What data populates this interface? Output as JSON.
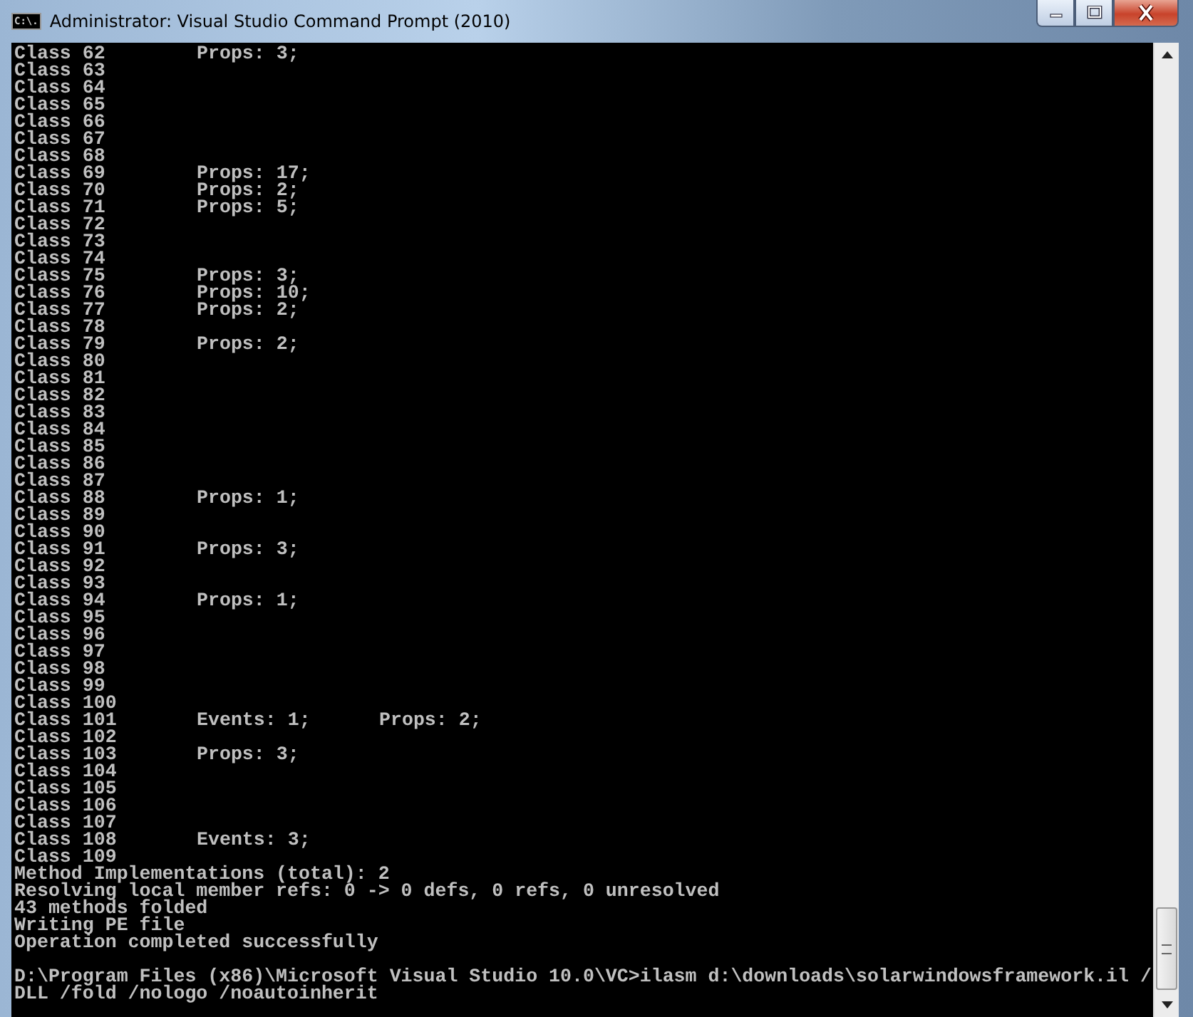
{
  "window": {
    "title": "Administrator: Visual Studio Command Prompt (2010)",
    "icon": "C:\\."
  },
  "console": {
    "lines": [
      [
        "Class 62",
        "Props: 3;"
      ],
      [
        "Class 63"
      ],
      [
        "Class 64"
      ],
      [
        "Class 65"
      ],
      [
        "Class 66"
      ],
      [
        "Class 67"
      ],
      [
        "Class 68"
      ],
      [
        "Class 69",
        "Props: 17;"
      ],
      [
        "Class 70",
        "Props: 2;"
      ],
      [
        "Class 71",
        "Props: 5;"
      ],
      [
        "Class 72"
      ],
      [
        "Class 73"
      ],
      [
        "Class 74"
      ],
      [
        "Class 75",
        "Props: 3;"
      ],
      [
        "Class 76",
        "Props: 10;"
      ],
      [
        "Class 77",
        "Props: 2;"
      ],
      [
        "Class 78"
      ],
      [
        "Class 79",
        "Props: 2;"
      ],
      [
        "Class 80"
      ],
      [
        "Class 81"
      ],
      [
        "Class 82"
      ],
      [
        "Class 83"
      ],
      [
        "Class 84"
      ],
      [
        "Class 85"
      ],
      [
        "Class 86"
      ],
      [
        "Class 87"
      ],
      [
        "Class 88",
        "Props: 1;"
      ],
      [
        "Class 89"
      ],
      [
        "Class 90"
      ],
      [
        "Class 91",
        "Props: 3;"
      ],
      [
        "Class 92"
      ],
      [
        "Class 93"
      ],
      [
        "Class 94",
        "Props: 1;"
      ],
      [
        "Class 95"
      ],
      [
        "Class 96"
      ],
      [
        "Class 97"
      ],
      [
        "Class 98"
      ],
      [
        "Class 99"
      ],
      [
        "Class 100"
      ],
      [
        "Class 101",
        "Events: 1;",
        "Props: 2;"
      ],
      [
        "Class 102"
      ],
      [
        "Class 103",
        "Props: 3;"
      ],
      [
        "Class 104"
      ],
      [
        "Class 105"
      ],
      [
        "Class 106"
      ],
      [
        "Class 107"
      ],
      [
        "Class 108",
        "Events: 3;"
      ],
      [
        "Class 109"
      ],
      [
        "Method Implementations (total): 2"
      ],
      [
        "Resolving local member refs: 0 -> 0 defs, 0 refs, 0 unresolved"
      ],
      [
        "43 methods folded"
      ],
      [
        "Writing PE file"
      ],
      [
        "Operation completed successfully"
      ]
    ],
    "prompt": [
      [
        "D:\\Program Files (x86)\\Microsoft Visual Studio 10.0\\VC>ilasm d:\\downloads\\solarwindowsframework.il /"
      ],
      [
        "DLL /fold /nologo /noautoinherit"
      ]
    ]
  }
}
